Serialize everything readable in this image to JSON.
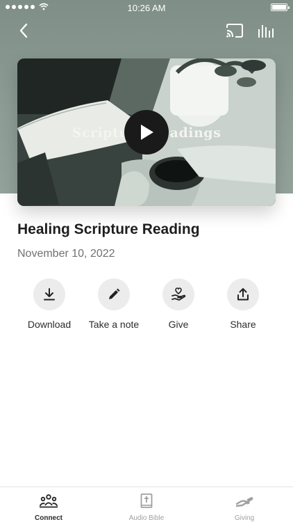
{
  "status_bar": {
    "time": "10:26 AM"
  },
  "video": {
    "overlay_title": "Scripture Readings"
  },
  "content": {
    "title": "Healing Scripture Reading",
    "date": "November 10, 2022"
  },
  "actions": [
    {
      "label": "Download",
      "icon": "download-icon"
    },
    {
      "label": "Take a note",
      "icon": "pencil-icon"
    },
    {
      "label": "Give",
      "icon": "hand-heart-icon"
    },
    {
      "label": "Share",
      "icon": "share-icon"
    }
  ],
  "tabs": [
    {
      "label": "Connect",
      "icon": "people-icon",
      "active": true
    },
    {
      "label": "Audio Bible",
      "icon": "bible-icon",
      "active": false
    },
    {
      "label": "Giving",
      "icon": "giving-hand-icon",
      "active": false
    }
  ],
  "colors": {
    "accent": "#1e1e1e",
    "hero": "#8e9d95",
    "inactive": "#a0a0a0"
  }
}
